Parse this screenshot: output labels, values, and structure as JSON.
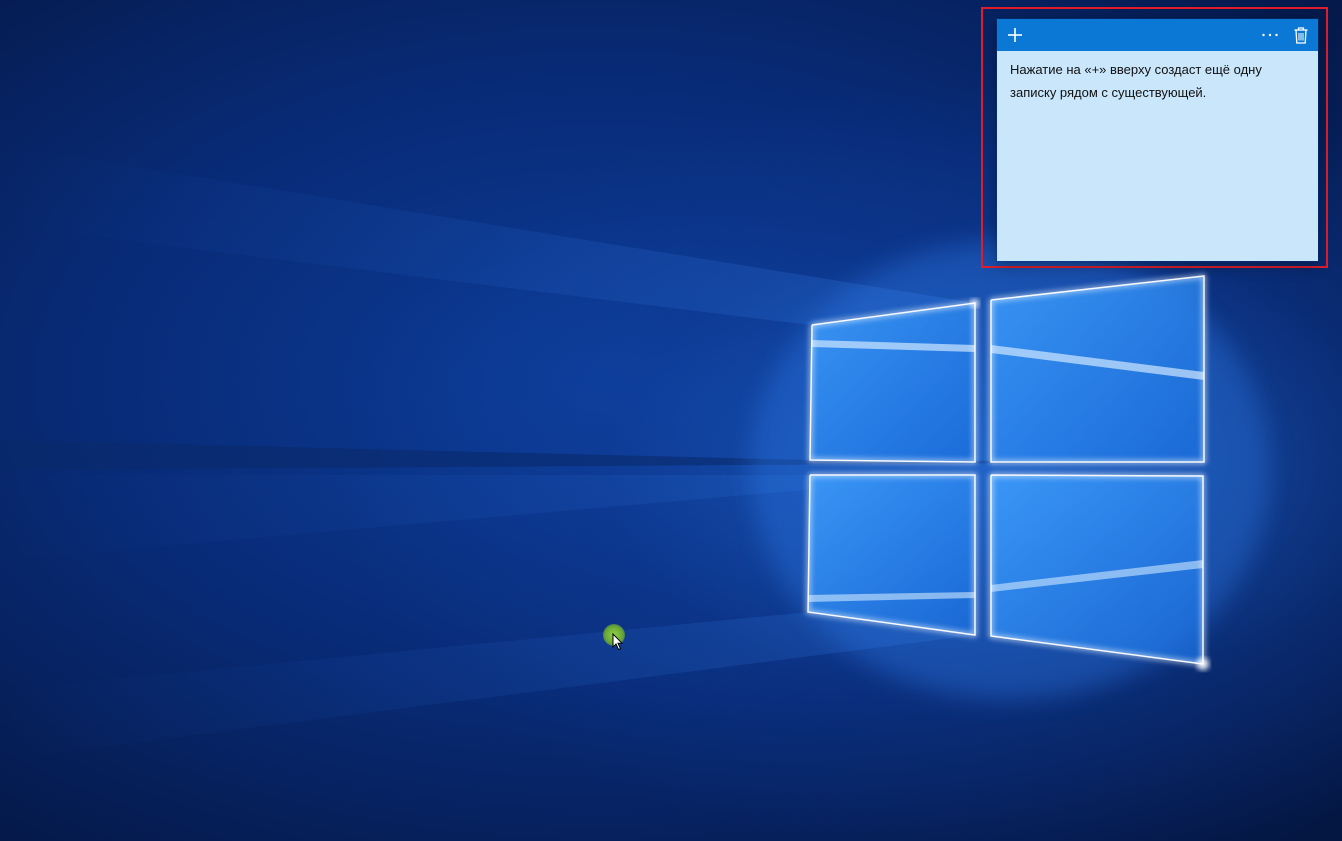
{
  "desktop": {
    "wallpaper_icon": "windows-logo-wallpaper",
    "accent_color": "#0a78d4",
    "background_color": "#082a75"
  },
  "sticky_note": {
    "text": "Нажатие на «+» вверху создаст ещё одну записку рядом с существующей.",
    "background_color": "#c9e6fb",
    "titlebar_color": "#0a78d4",
    "highlight_border_color": "#e01e2a",
    "add_icon": "plus-icon",
    "menu_icon": "ellipsis-icon",
    "delete_icon": "trash-icon"
  },
  "cursor": {
    "icon": "arrow-cursor-icon",
    "highlight_color": "#8fd14a"
  }
}
